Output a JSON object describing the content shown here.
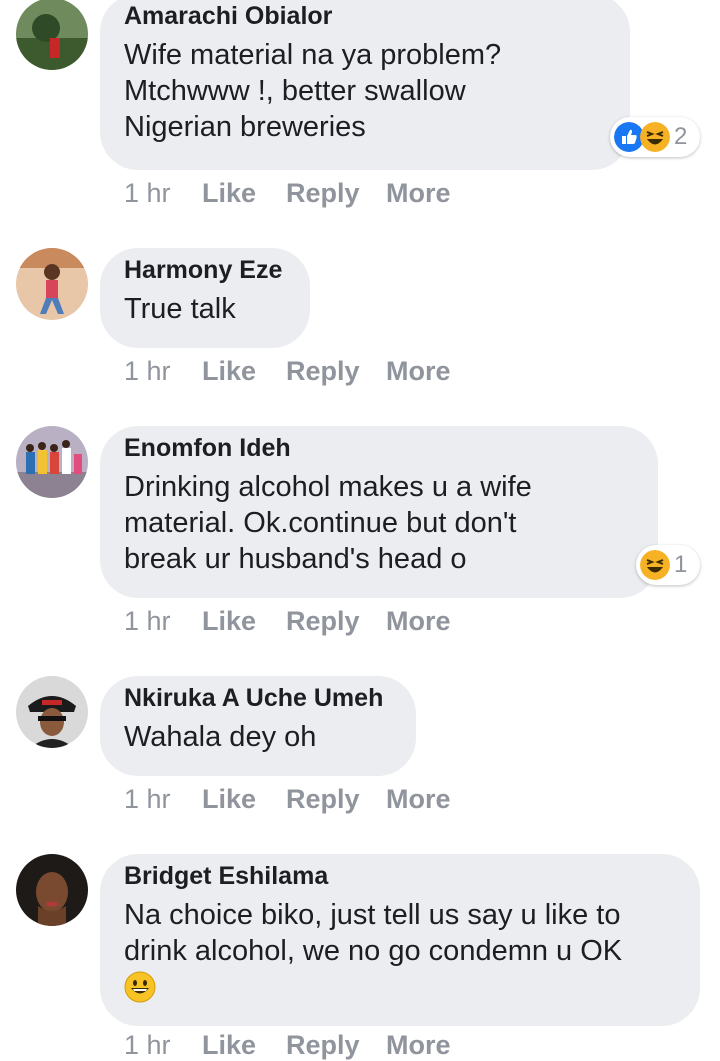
{
  "comments": [
    {
      "author": "Amarachi Obialor",
      "text": "Wife material na ya problem?\nMtchwww !, better swallow\nNigerian breweries",
      "time": "1 hr",
      "like": "Like",
      "reply": "Reply",
      "more": "More",
      "reactions": {
        "icons": [
          "like-reaction",
          "haha-reaction"
        ],
        "count": "2"
      }
    },
    {
      "author": "Harmony Eze",
      "text": "True talk",
      "time": "1 hr",
      "like": "Like",
      "reply": "Reply",
      "more": "More"
    },
    {
      "author": "Enomfon Ideh",
      "text": "Drinking alcohol makes u a wife\nmaterial. Ok.continue but don't\nbreak ur husband's head o",
      "time": "1 hr",
      "like": "Like",
      "reply": "Reply",
      "more": "More",
      "reactions": {
        "icons": [
          "haha-reaction"
        ],
        "count": "1"
      }
    },
    {
      "author": "Nkiruka A Uche Umeh",
      "text": "Wahala dey oh",
      "time": "1 hr",
      "like": "Like",
      "reply": "Reply",
      "more": "More"
    },
    {
      "author": "Bridget Eshilama",
      "text": "Na choice biko, just tell us say u like to\ndrink alcohol, we no go condemn u OK",
      "emoji": "grinning-face-emoji",
      "time": "1 hr",
      "like": "Like",
      "reply": "Reply",
      "more": "More"
    }
  ],
  "colors": {
    "bubble": "#ebedf0",
    "meta": "#90949c",
    "text": "#1c1e21",
    "like_blue": "#1877f2",
    "haha_yellow": "#f7b125"
  }
}
